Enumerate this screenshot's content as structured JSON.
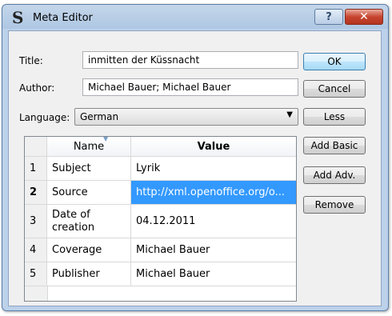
{
  "window": {
    "title": "Meta Editor",
    "app_icon": "S",
    "help_glyph": "?",
    "close_glyph": "✕"
  },
  "form": {
    "title_label": "Title:",
    "title_value": "inmitten der Küssnacht",
    "author_label": "Author:",
    "author_value": "Michael Bauer; Michael Bauer",
    "language_label": "Language:",
    "language_value": "German"
  },
  "buttons": {
    "ok": "OK",
    "cancel": "Cancel",
    "less": "Less",
    "add_basic": "Add Basic",
    "add_adv": "Add Adv.",
    "remove": "Remove"
  },
  "table": {
    "headers": {
      "name": "Name",
      "value": "Value"
    },
    "rows": [
      {
        "num": "1",
        "name": "Subject",
        "value": "Lyrik"
      },
      {
        "num": "2",
        "name": "Source",
        "value": "http://xml.openoffice.org/o..."
      },
      {
        "num": "3",
        "name": "Date of creation",
        "value": "04.12.2011"
      },
      {
        "num": "4",
        "name": "Coverage",
        "value": "Michael Bauer"
      },
      {
        "num": "5",
        "name": "Publisher",
        "value": "Michael Bauer"
      }
    ],
    "selected_row": 2
  },
  "colors": {
    "selection": "#3399ff",
    "close_button": "#c7452f",
    "title_bar": "#b9cfe8"
  }
}
